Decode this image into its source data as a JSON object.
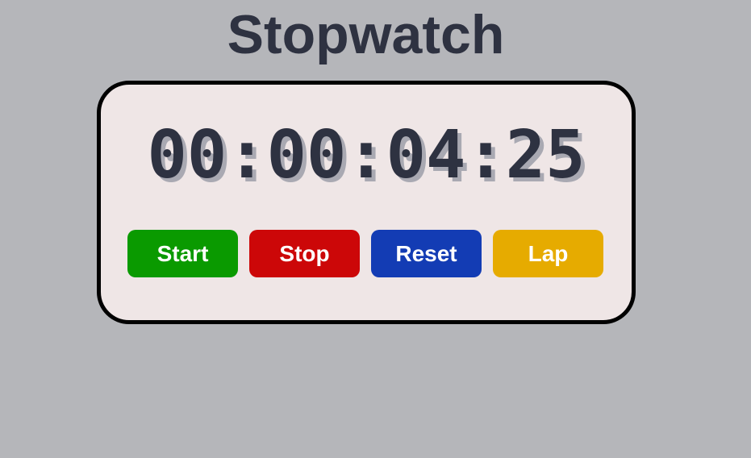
{
  "app": {
    "title": "Stopwatch"
  },
  "display": {
    "time": "00:00:04:25"
  },
  "controls": {
    "buttons": [
      {
        "label": "Start",
        "color": "#0a9a00"
      },
      {
        "label": "Stop",
        "color": "#cc0708"
      },
      {
        "label": "Reset",
        "color": "#133cb4"
      },
      {
        "label": "Lap",
        "color": "#e6ab00"
      }
    ]
  },
  "colors": {
    "background": "#b5b6ba",
    "panel": "#efe6e6",
    "text": "#2e3241"
  }
}
